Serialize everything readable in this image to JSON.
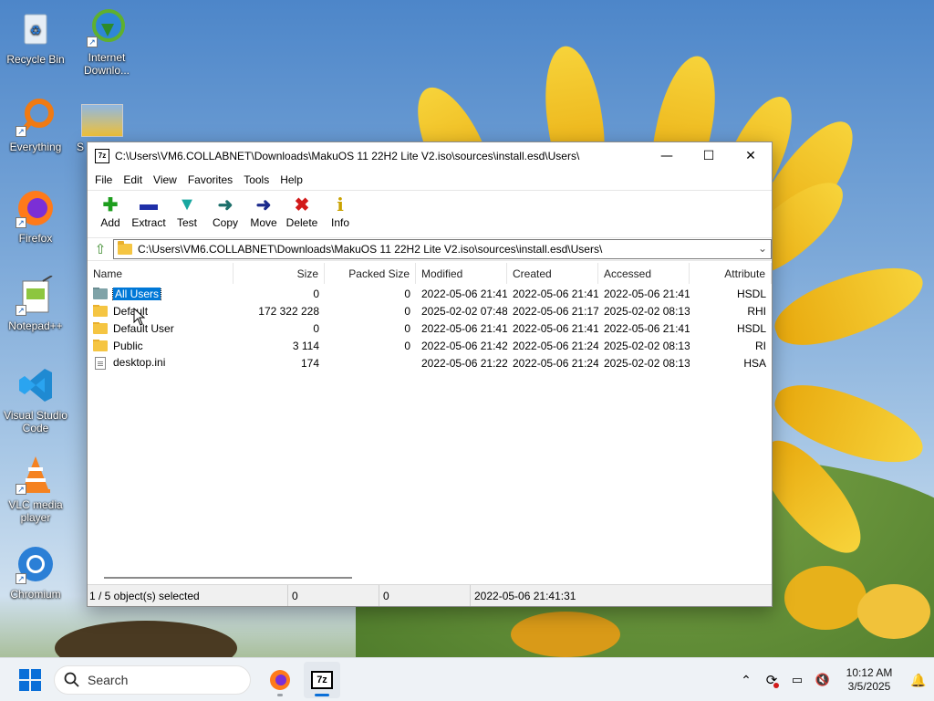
{
  "desktop": {
    "icons": [
      {
        "label": "Recycle Bin",
        "icon": "recycle-bin-icon"
      },
      {
        "label": "Internet Downlo...",
        "icon": "internet-download-manager-icon"
      },
      {
        "label": "Everything",
        "icon": "everything-search-icon"
      },
      {
        "label": "Firefox",
        "icon": "firefox-icon"
      },
      {
        "label": "Notepad++",
        "icon": "notepad-plus-plus-icon"
      },
      {
        "label": "Visual Studio Code",
        "icon": "vscode-icon"
      },
      {
        "label": "VLC media player",
        "icon": "vlc-icon"
      },
      {
        "label": "Chromium",
        "icon": "chromium-icon"
      }
    ],
    "partial_label": "S"
  },
  "window": {
    "app_icon_text": "7z",
    "title": "C:\\Users\\VM6.COLLABNET\\Downloads\\MakuOS 11 22H2 Lite V2.iso\\sources\\install.esd\\Users\\",
    "controls": {
      "minimize": "—",
      "maximize": "☐",
      "close": "✕"
    }
  },
  "menu": [
    "File",
    "Edit",
    "View",
    "Favorites",
    "Tools",
    "Help"
  ],
  "toolbar": [
    {
      "label": "Add",
      "icon": "add-icon",
      "glyph": "✚",
      "color": "#1e9e1e"
    },
    {
      "label": "Extract",
      "icon": "extract-icon",
      "glyph": "▬",
      "color": "#1f2fa8"
    },
    {
      "label": "Test",
      "icon": "test-icon",
      "glyph": "▼",
      "color": "#18a7a0"
    },
    {
      "label": "Copy",
      "icon": "copy-icon",
      "glyph": "➜",
      "color": "#1d6f6a"
    },
    {
      "label": "Move",
      "icon": "move-icon",
      "glyph": "➜",
      "color": "#1b2a8c"
    },
    {
      "label": "Delete",
      "icon": "delete-icon",
      "glyph": "✖",
      "color": "#d21a1a"
    },
    {
      "label": "Info",
      "icon": "info-icon",
      "glyph": "i",
      "color": "#c9a200"
    }
  ],
  "address": {
    "path": "C:\\Users\\VM6.COLLABNET\\Downloads\\MakuOS 11 22H2 Lite V2.iso\\sources\\install.esd\\Users\\"
  },
  "columns": [
    "Name",
    "Size",
    "Packed Size",
    "Modified",
    "Created",
    "Accessed",
    "Attribute"
  ],
  "files": [
    {
      "name": "All Users",
      "type": "folder-special",
      "size": "0",
      "packed": "0",
      "modified": "2022-05-06 21:41",
      "created": "2022-05-06 21:41",
      "accessed": "2022-05-06 21:41",
      "attr": "HSDL",
      "selected": true
    },
    {
      "name": "Default",
      "type": "folder",
      "size": "172 322 228",
      "packed": "0",
      "modified": "2025-02-02 07:48",
      "created": "2022-05-06 21:17",
      "accessed": "2025-02-02 08:13",
      "attr": "RHI"
    },
    {
      "name": "Default User",
      "type": "folder",
      "size": "0",
      "packed": "0",
      "modified": "2022-05-06 21:41",
      "created": "2022-05-06 21:41",
      "accessed": "2022-05-06 21:41",
      "attr": "HSDL"
    },
    {
      "name": "Public",
      "type": "folder",
      "size": "3 114",
      "packed": "0",
      "modified": "2022-05-06 21:42",
      "created": "2022-05-06 21:24",
      "accessed": "2025-02-02 08:13",
      "attr": "RI"
    },
    {
      "name": "desktop.ini",
      "type": "file",
      "size": "174",
      "packed": "",
      "modified": "2022-05-06 21:22",
      "created": "2022-05-06 21:24",
      "accessed": "2025-02-02 08:13",
      "attr": "HSA"
    }
  ],
  "status": {
    "selection": "1 / 5 object(s) selected",
    "size": "0",
    "packed": "0",
    "modified": "2022-05-06 21:41:31"
  },
  "taskbar": {
    "search_placeholder": "Search",
    "apps": [
      {
        "icon": "firefox-icon"
      },
      {
        "icon": "7zip-icon",
        "label": "7z",
        "active": true
      }
    ],
    "time": "10:12 AM",
    "date": "3/5/2025"
  }
}
